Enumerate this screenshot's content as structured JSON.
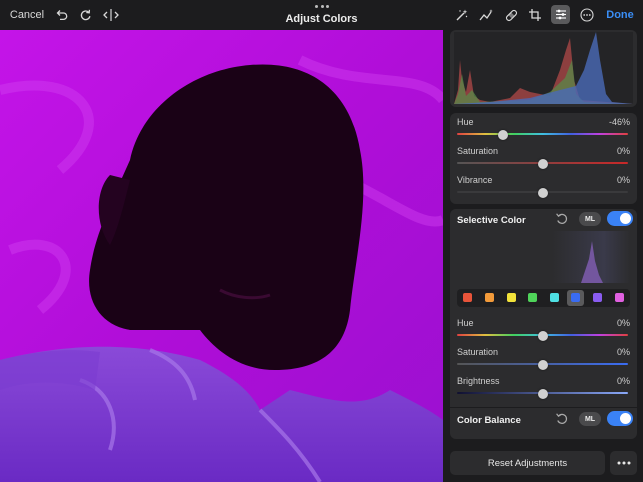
{
  "toolbar": {
    "cancel_label": "Cancel",
    "title": "Adjust Colors",
    "done_label": "Done",
    "accent": "#3a82f6"
  },
  "basic": {
    "hue_label": "Hue",
    "hue_value": "-46%",
    "hue_level": -0.46,
    "saturation_label": "Saturation",
    "saturation_value": "0%",
    "saturation_level": 0,
    "vibrance_label": "Vibrance",
    "vibrance_value": "0%",
    "vibrance_level": 0
  },
  "selective_color": {
    "title": "Selective Color",
    "ml_label": "ML",
    "enabled": true,
    "swatches": [
      "#e8543a",
      "#f29a3a",
      "#f2e23a",
      "#4fd45a",
      "#4fe0e4",
      "#3a6cf2",
      "#8a5cf0",
      "#e060e0"
    ],
    "selected_swatch": 5,
    "hue_label": "Hue",
    "hue_value": "0%",
    "hue_level": 0,
    "saturation_label": "Saturation",
    "saturation_value": "0%",
    "saturation_level": 0,
    "brightness_label": "Brightness",
    "brightness_value": "0%",
    "brightness_level": 0
  },
  "color_balance": {
    "title": "Color Balance",
    "ml_label": "ML",
    "enabled": true
  },
  "footer": {
    "reset_label": "Reset Adjustments"
  }
}
